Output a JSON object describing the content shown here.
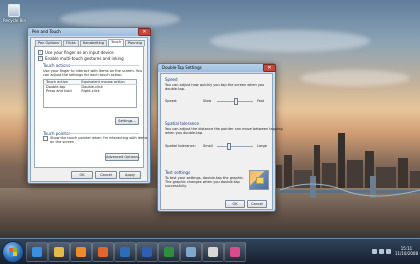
{
  "desktop": {
    "icons": [
      {
        "label": "Recycle Bin",
        "icon": "recycle-bin-icon"
      }
    ]
  },
  "pen_touch": {
    "title": "Pen and Touch",
    "tabs": [
      {
        "label": "Pen Options"
      },
      {
        "label": "Flicks"
      },
      {
        "label": "Handwriting"
      },
      {
        "label": "Touch",
        "active": true
      },
      {
        "label": "Panning"
      }
    ],
    "checks": [
      {
        "label": "Use your finger as an input device",
        "checked": true
      },
      {
        "label": "Enable multi-touch gestures and inking",
        "checked": true
      }
    ],
    "touch_actions": {
      "title": "Touch actions",
      "desc1": "Use your finger to interact with items on the screen. You",
      "desc2": "can adjust the settings for each touch action.",
      "columns": [
        "Touch action",
        "Equivalent mouse action"
      ],
      "rows": [
        [
          "Double-tap",
          "Double-click"
        ],
        [
          "Press and hold",
          "Right-click"
        ]
      ],
      "settings_button": "Settings..."
    },
    "touch_pointer": {
      "title": "Touch pointer",
      "check_label1": "Show the touch pointer when I'm interacting with items",
      "check_label2": "on the screen",
      "advanced_button": "Advanced Options..."
    },
    "buttons": {
      "ok": "OK",
      "cancel": "Cancel",
      "apply": "Apply"
    }
  },
  "double_tap": {
    "title": "Double-Tap Settings",
    "speed": {
      "title": "Speed",
      "desc1": "You can adjust how quickly you tap the screen when you",
      "desc2": "double-tap.",
      "label": "Speed:",
      "min": "Slow",
      "max": "Fast",
      "level": 0.5
    },
    "tolerance": {
      "title": "Spatial tolerance",
      "desc1": "You can adjust the distance the pointer can move between tapping",
      "desc2": "when you double-tap.",
      "label": "Spatial tolerance:",
      "min": "Small",
      "max": "Large",
      "level": 0.3
    },
    "test": {
      "title": "Test settings",
      "desc1": "To test your settings, double-tap the graphic.",
      "desc2": "The graphic changes when you double-tap",
      "desc3": "successfully."
    },
    "buttons": {
      "ok": "OK",
      "cancel": "Cancel"
    }
  },
  "taskbar": {
    "pinned": [
      {
        "icon": "internet-explorer-icon",
        "color": "#3a8fe0"
      },
      {
        "icon": "windows-explorer-icon",
        "color": "#e5b84a"
      },
      {
        "icon": "media-player-icon",
        "color": "#f08a2a"
      },
      {
        "icon": "firefox-icon",
        "color": "#e0662a"
      },
      {
        "icon": "photoshop-icon",
        "color": "#2c6cb8"
      },
      {
        "icon": "word-icon",
        "color": "#2f5fb3"
      },
      {
        "icon": "excel-icon",
        "color": "#2f8f3f"
      },
      {
        "icon": "control-panel-icon",
        "color": "#7fa7d0"
      },
      {
        "icon": "pen-touch-icon",
        "color": "#d8d8d8"
      },
      {
        "icon": "paint-icon",
        "color": "#d94b8a"
      }
    ],
    "clock_time": "15:11",
    "clock_date": "11/10/2008"
  }
}
